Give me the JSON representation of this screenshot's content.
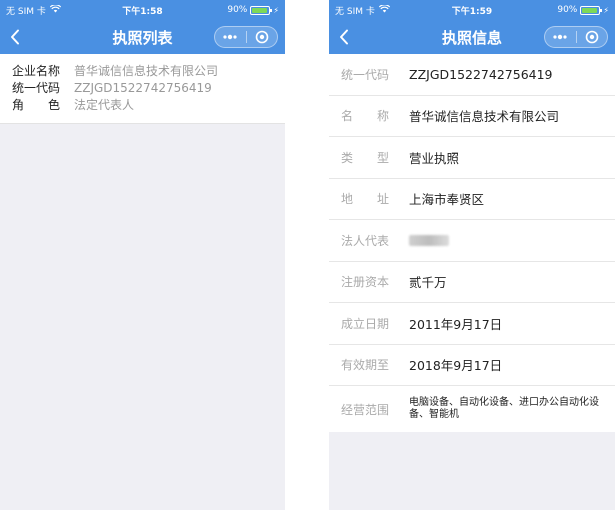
{
  "left": {
    "status": {
      "carrier": "无 SIM 卡",
      "time": "下午1:58",
      "battery": "90%",
      "battery_level": 0.9
    },
    "nav": {
      "title": "执照列表"
    },
    "card": {
      "rows": [
        {
          "label": "企业名称",
          "value": "普华诚信信息技术有限公司"
        },
        {
          "label": "统一代码",
          "value": "ZZJGD1522742756419"
        },
        {
          "label": "角　　色",
          "value": "法定代表人"
        }
      ]
    }
  },
  "right": {
    "status": {
      "carrier": "无 SIM 卡",
      "time": "下午1:59",
      "battery": "90%",
      "battery_level": 0.9
    },
    "nav": {
      "title": "执照信息"
    },
    "details": [
      {
        "label": "统一代码",
        "value": "ZZJGD1522742756419"
      },
      {
        "label": "名　　称",
        "value": "普华诚信信息技术有限公司"
      },
      {
        "label": "类　　型",
        "value": "营业执照"
      },
      {
        "label": "地　　址",
        "value": "上海市奉贤区"
      },
      {
        "label": "法人代表",
        "value": ""
      },
      {
        "label": "注册资本",
        "value": "贰千万"
      },
      {
        "label": "成立日期",
        "value": "2011年9月17日"
      },
      {
        "label": "有效期至",
        "value": "2018年9月17日"
      },
      {
        "label": "经营范围",
        "value": "电脑设备、自动化设备、进口办公自动化设备、智能机"
      }
    ]
  },
  "colors": {
    "primary": "#4a90e2",
    "background": "#efeff4",
    "battery": "#7ed957"
  },
  "icons": {
    "back": "chevron-left-icon",
    "more": "more-dots-icon",
    "close": "target-circle-icon",
    "wifi": "wifi-icon"
  }
}
